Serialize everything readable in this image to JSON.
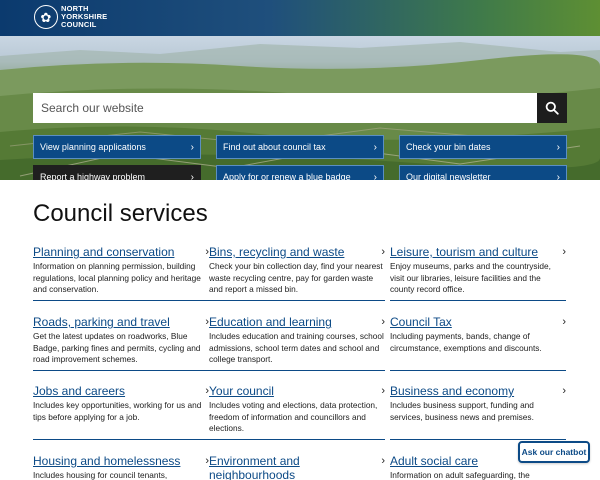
{
  "header": {
    "logo_line1": "NORTH",
    "logo_line2": "YORKSHIRE",
    "logo_line3": "COUNCIL"
  },
  "search": {
    "placeholder": "Search our website"
  },
  "quick_links": [
    {
      "label": "View planning applications",
      "style": "blue"
    },
    {
      "label": "Find out about council tax",
      "style": "blue"
    },
    {
      "label": "Check your bin dates",
      "style": "blue"
    },
    {
      "label": "Report a highway problem",
      "style": "dark"
    },
    {
      "label": "Apply for or renew a blue badge",
      "style": "blue"
    },
    {
      "label": "Our digital newsletter",
      "style": "blue"
    }
  ],
  "services": {
    "title": "Council services",
    "items": [
      {
        "title": "Planning and conservation",
        "desc": "Information on planning permission, building regulations, local planning policy and heritage and conservation."
      },
      {
        "title": "Bins, recycling and waste",
        "desc": "Check your bin collection day, find your nearest waste recycling centre, pay for garden waste and report a missed bin."
      },
      {
        "title": "Leisure, tourism and culture",
        "desc": "Enjoy museums, parks and the countryside, visit our libraries, leisure facilities and the county record office."
      },
      {
        "title": "Roads, parking and travel",
        "desc": "Get the latest updates on roadworks, Blue Badge, parking fines and permits, cycling and road improvement schemes."
      },
      {
        "title": "Education and learning",
        "desc": "Includes education and training courses, school admissions, school term dates and school and college transport."
      },
      {
        "title": "Council Tax",
        "desc": "Including payments, bands, change of circumstance, exemptions and discounts."
      },
      {
        "title": "Jobs and careers",
        "desc": "Includes key opportunities, working for us and tips before applying for a job."
      },
      {
        "title": "Your council",
        "desc": "Includes voting and elections, data protection, freedom of information and councillors and elections."
      },
      {
        "title": "Business and economy",
        "desc": "Includes business support, funding and services, business news and premises."
      },
      {
        "title": "Housing and homelessness",
        "desc": "Includes housing for council tenants,"
      },
      {
        "title": "Environment and neighbourhoods",
        "desc": ""
      },
      {
        "title": "Adult social care",
        "desc": "Information on adult safeguarding, the"
      }
    ]
  },
  "chatbot": {
    "label": "Ask our chatbot"
  },
  "colors": {
    "brand_blue": "#0c4a86",
    "dark": "#1f1f1f"
  }
}
